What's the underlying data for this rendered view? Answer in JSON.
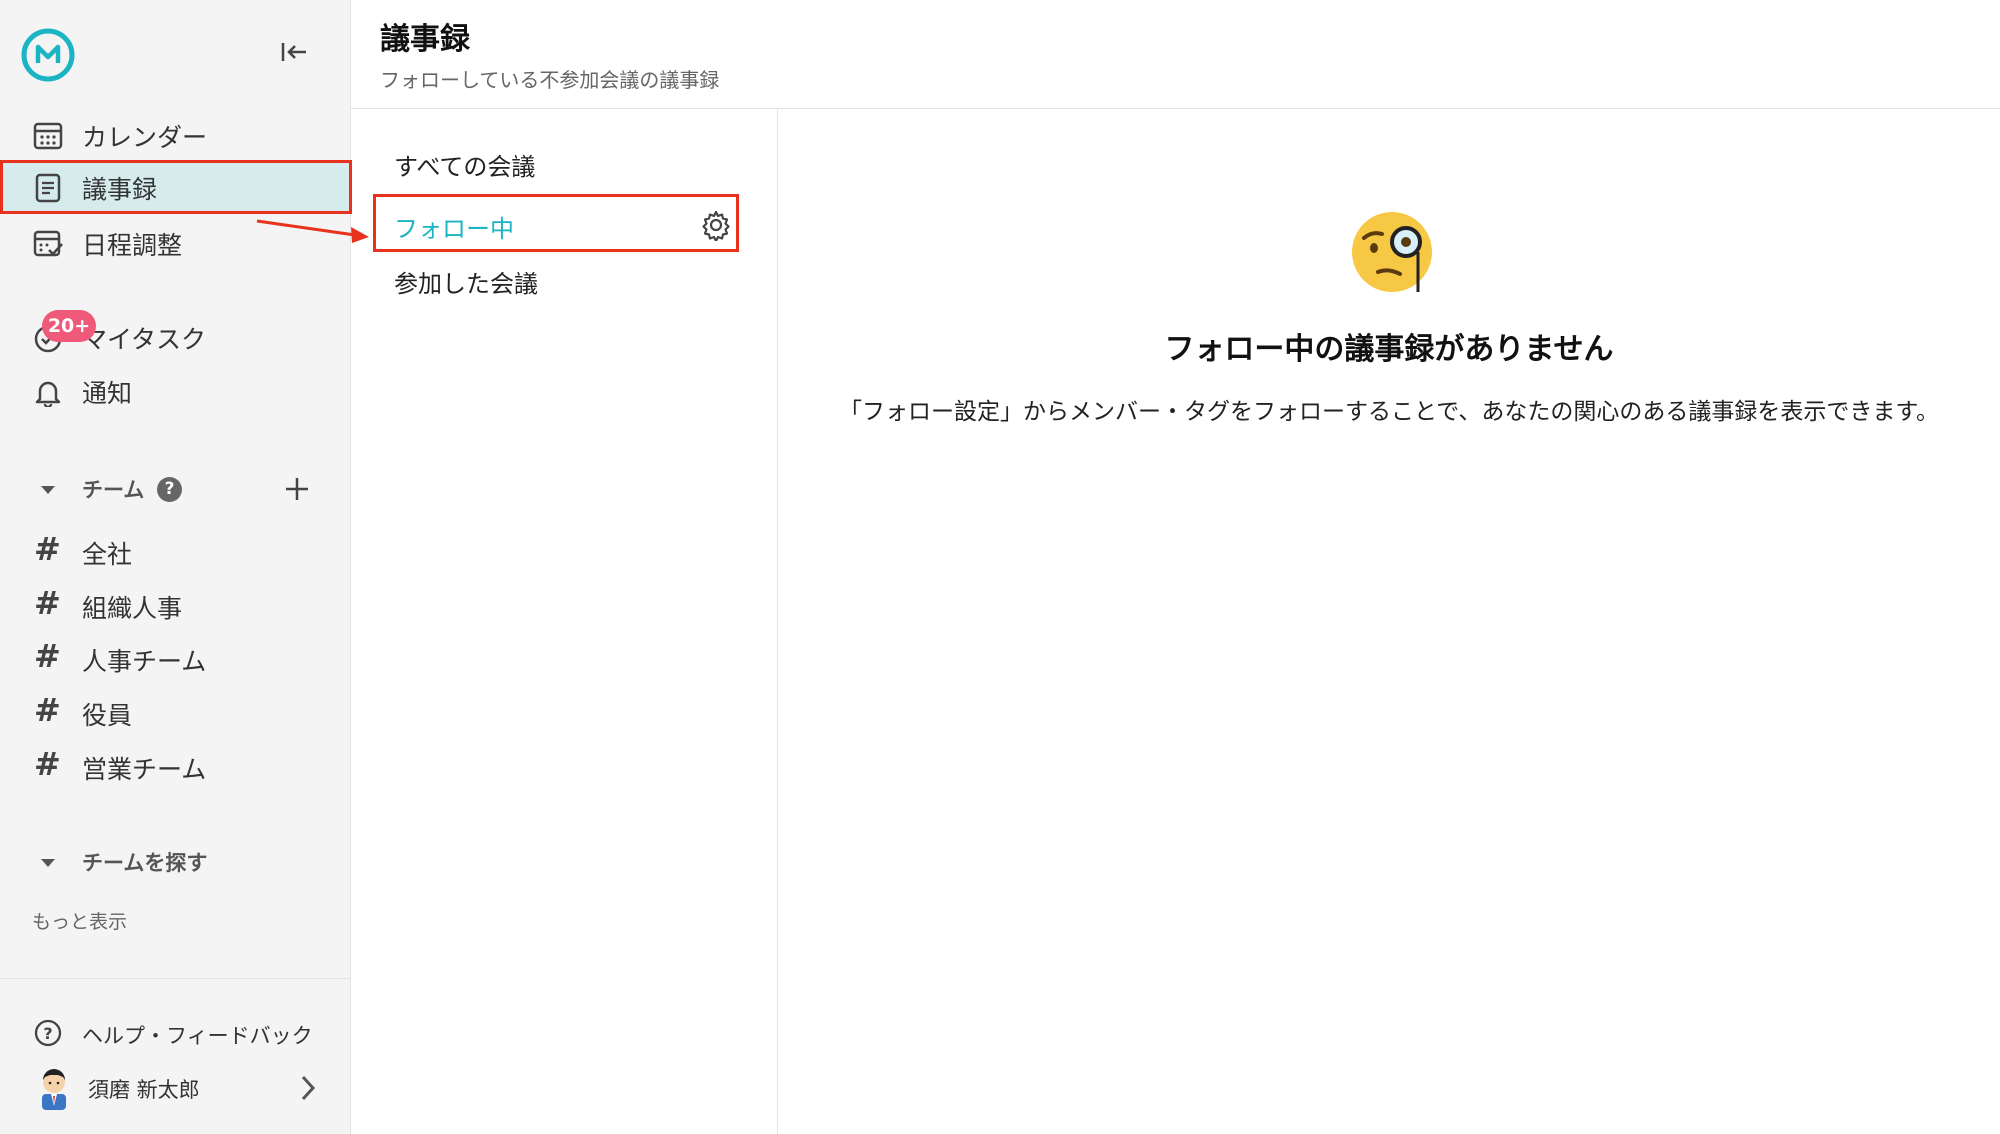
{
  "colors": {
    "accent": "#1ab4c4",
    "highlight": "#e8321e",
    "badge": "#ef5a7a",
    "active_bg": "#d6ecec"
  },
  "sidebar": {
    "logo_icon": "app-logo-icon",
    "collapse_icon": "collapse-left-icon",
    "nav": [
      {
        "label": "カレンダー",
        "icon": "calendar-icon"
      },
      {
        "label": "議事録",
        "icon": "document-icon",
        "active": true
      },
      {
        "label": "日程調整",
        "icon": "schedule-check-icon"
      },
      {
        "label": "マイタスク",
        "icon": "task-icon",
        "badge": "20+"
      },
      {
        "label": "通知",
        "icon": "bell-icon"
      }
    ],
    "teams_header": "チーム",
    "teams": [
      "全社",
      "組織人事",
      "人事チーム",
      "役員",
      "営業チーム"
    ],
    "find_teams_header": "チームを探す",
    "show_more": "もっと表示",
    "help": "ヘルプ・フィードバック",
    "user_name": "須磨 新太郎"
  },
  "header": {
    "title": "議事録",
    "subtitle": "フォローしている不参加会議の議事録"
  },
  "filters": {
    "all": "すべての会議",
    "following": "フォロー中",
    "joined": "参加した会議"
  },
  "empty": {
    "title": "フォロー中の議事録がありません",
    "description": "「フォロー設定」からメンバー・タグをフォローすることで、あなたの関心のある議事録を表示できます。"
  }
}
